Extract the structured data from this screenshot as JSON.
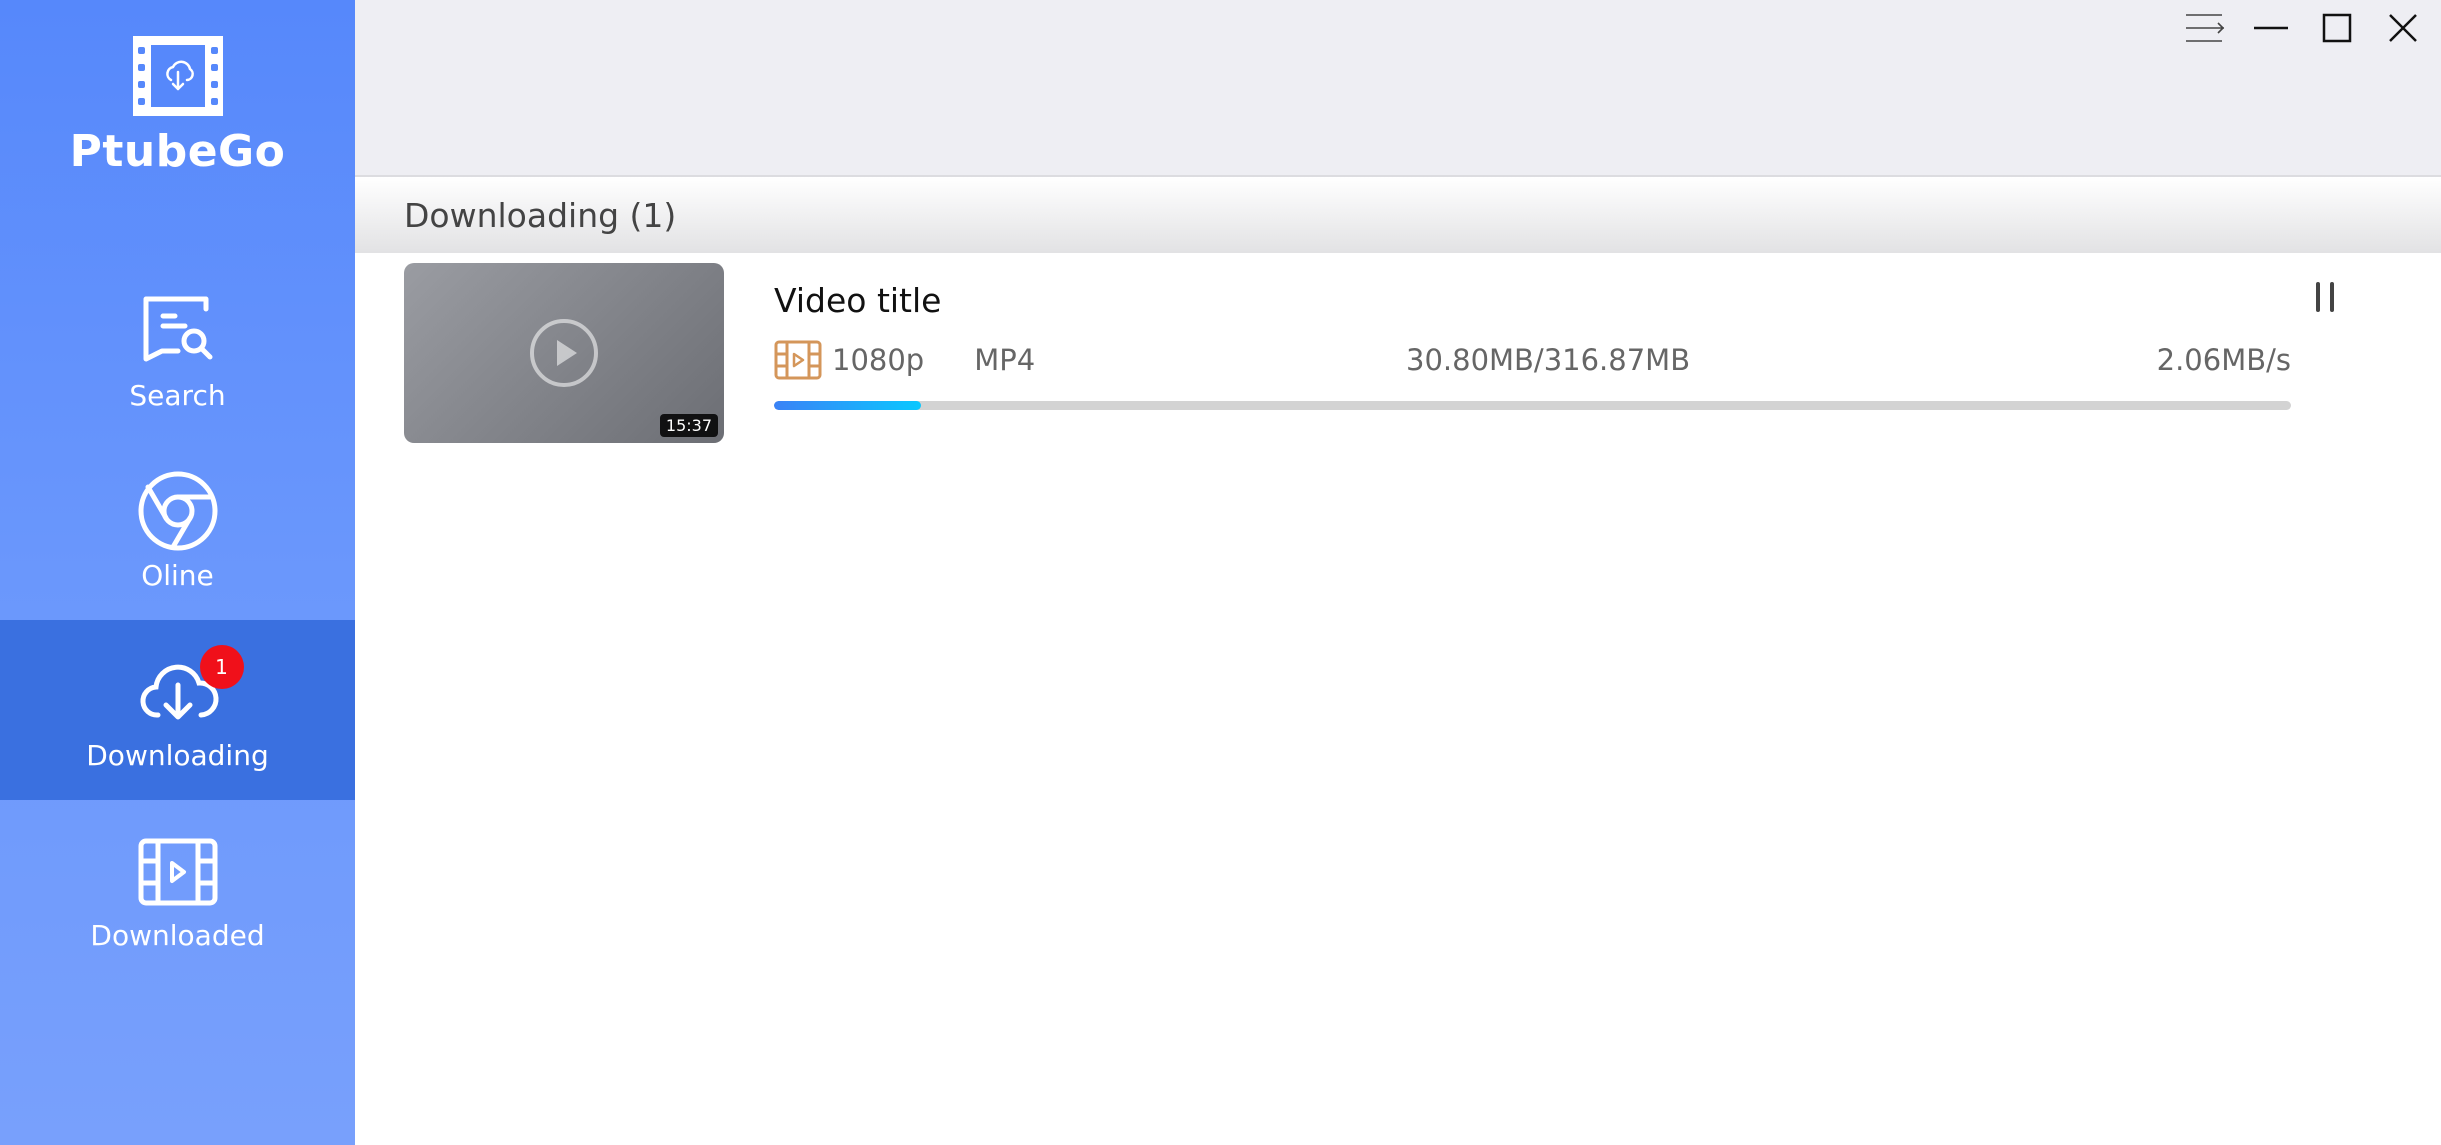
{
  "app": {
    "name": "PtubeGo",
    "logo_icon": "film-cloud-download-icon"
  },
  "sidebar": {
    "items": [
      {
        "label": "Search",
        "icon": "search-chat-icon",
        "active": false
      },
      {
        "label": "Oline",
        "icon": "browser-icon",
        "active": false
      },
      {
        "label": "Downloading",
        "icon": "cloud-download-icon",
        "active": true,
        "badge": "1"
      },
      {
        "label": "Downloaded",
        "icon": "film-play-icon",
        "active": false
      }
    ]
  },
  "window_controls": {
    "menu": "menu-icon",
    "minimize": "minimize-icon",
    "maximize": "maximize-icon",
    "close": "close-icon"
  },
  "section": {
    "title": "Downloading (1)"
  },
  "downloads": [
    {
      "title": "Video title",
      "thumbnail": "video-thumbnail-placeholder",
      "duration": "15:37",
      "resolution": "1080p",
      "format": "MP4",
      "size_progress": "30.80MB/316.87MB",
      "speed": "2.06MB/s",
      "progress_percent": 9.7,
      "action": "pause"
    }
  ],
  "colors": {
    "sidebar_top": "#5688fb",
    "sidebar_active": "#3a70e0",
    "badge": "#f0101a",
    "progress_start": "#3b82f6",
    "progress_end": "#0ac8ff",
    "resolution_icon": "#d4965a"
  }
}
